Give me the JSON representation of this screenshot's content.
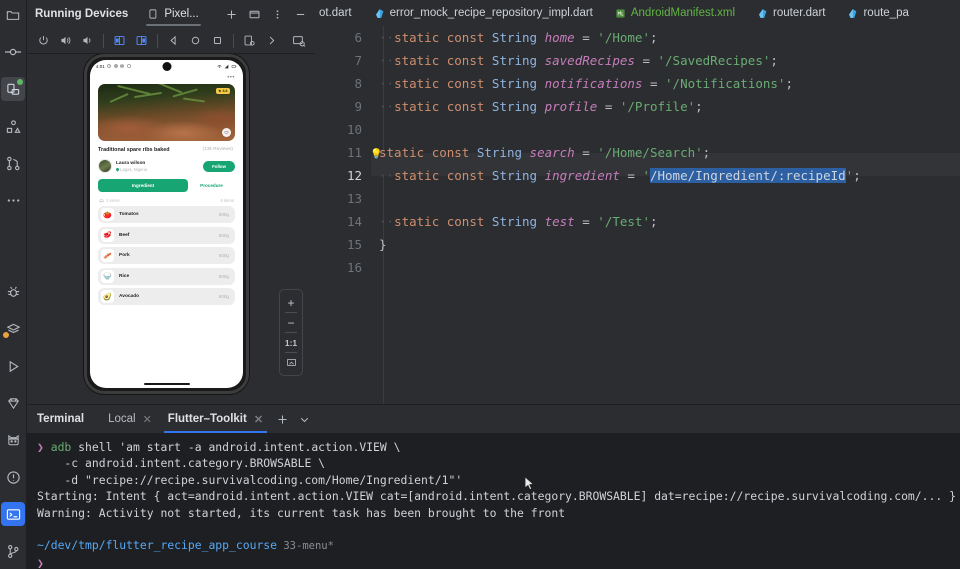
{
  "left_rail": {
    "items": [
      {
        "name": "project-folder-icon",
        "label": "Project"
      },
      {
        "name": "commit-icon",
        "label": "Commit"
      },
      {
        "name": "running-devices-icon",
        "label": "Running Devices",
        "selected": true,
        "badge": "green"
      },
      {
        "name": "structure-icon",
        "label": "Structure"
      },
      {
        "name": "pull-requests-icon",
        "label": "Pull Requests"
      },
      {
        "name": "more-tool-windows-icon",
        "label": "More"
      }
    ],
    "bottom_items": [
      {
        "name": "debug-icon",
        "label": "Debug"
      },
      {
        "name": "layers-icon",
        "label": "Layers",
        "badge": "amber"
      },
      {
        "name": "run-icon",
        "label": "Run"
      },
      {
        "name": "flutter-diamond-icon",
        "label": "Flutter Inspector"
      },
      {
        "name": "cat-icon",
        "label": "Dart Analysis"
      },
      {
        "name": "problems-icon",
        "label": "Problems"
      },
      {
        "name": "terminal-icon",
        "label": "Terminal",
        "selected": true
      },
      {
        "name": "version-control-icon",
        "label": "Version Control"
      }
    ]
  },
  "running_devices": {
    "title": "Running Devices",
    "tab_label": "Pixel...",
    "header_actions": [
      {
        "name": "add-device-button",
        "glyph": "+"
      },
      {
        "name": "split-window-button",
        "glyph": "▭"
      },
      {
        "name": "options-button",
        "glyph": "⋮"
      },
      {
        "name": "hide-button",
        "glyph": "—"
      }
    ],
    "toolbar": [
      {
        "name": "power-button",
        "label": "Power"
      },
      {
        "name": "volume-up-button",
        "label": "Volume Up"
      },
      {
        "name": "volume-down-button",
        "label": "Volume Down"
      },
      {
        "name": "rotate-left-button",
        "label": "Rotate Left"
      },
      {
        "name": "rotate-right-button",
        "label": "Rotate Right"
      },
      {
        "name": "back-button",
        "label": "Back"
      },
      {
        "name": "home-button",
        "label": "Home"
      },
      {
        "name": "overview-button",
        "label": "Overview"
      },
      {
        "name": "screenshot-button",
        "label": "Screenshot"
      },
      {
        "name": "more-actions-button",
        "label": "More"
      },
      {
        "name": "device-settings-button",
        "label": "Device Settings"
      }
    ],
    "zoom_controls": {
      "zoom_in": "+",
      "zoom_out": "−",
      "actual_size": "1:1",
      "fit_to_screen": "fit"
    }
  },
  "emulator": {
    "status_bar": {
      "time": "4:01",
      "left_icons": [
        "clock-icon",
        "gear-icon",
        "camera-icon",
        "app-icon"
      ],
      "right_icons": [
        "wifi-icon",
        "signal-icon",
        "battery-icon"
      ]
    },
    "app": {
      "overflow_menu": "•••",
      "rating_badge": "4.6",
      "recipe_title": "Traditional spare ribs baked",
      "reviews": "(13k Reviews)",
      "author_name": "Laura wilson",
      "author_location": "Lagos, Nigeria",
      "follow_label": "Follow",
      "tab_ingredient": "Ingredient",
      "tab_procedure": "Procedure",
      "serves_label": "1 serve",
      "items_label": "6 items",
      "ingredients": [
        {
          "icon": "🍅",
          "name": "Tomatos",
          "amount": "500g"
        },
        {
          "icon": "🥩",
          "name": "Beef",
          "amount": "500g"
        },
        {
          "icon": "🥓",
          "name": "Pork",
          "amount": "500g"
        },
        {
          "icon": "🍚",
          "name": "Rice",
          "amount": "500g"
        },
        {
          "icon": "🥑",
          "name": "Avocado",
          "amount": "500g"
        }
      ]
    }
  },
  "editor": {
    "tabs": [
      {
        "name": "tab-bot-dart",
        "label": "ot.dart",
        "icon": "dart-icon",
        "type": "dart",
        "clipped": true
      },
      {
        "name": "tab-error-mock-recipe-repository-impl",
        "label": "error_mock_recipe_repository_impl.dart",
        "icon": "dart-icon",
        "type": "dart"
      },
      {
        "name": "tab-android-manifest",
        "label": "AndroidManifest.xml",
        "icon": "xml-icon",
        "type": "xml"
      },
      {
        "name": "tab-router-dart",
        "label": "router.dart",
        "icon": "dart-icon",
        "type": "dart"
      },
      {
        "name": "tab-route-paths",
        "label": "route_pa",
        "icon": "dart-icon",
        "type": "dart",
        "clipped": true
      }
    ],
    "current_line": 12,
    "selection": "/Home/Ingredient/:recipeId",
    "lines": [
      {
        "num": 6,
        "tokens": [
          {
            "t": "··",
            "c": "dotsep"
          },
          {
            "t": "static",
            "c": "kw"
          },
          {
            "t": " ",
            "c": "op"
          },
          {
            "t": "const",
            "c": "kw"
          },
          {
            "t": " ",
            "c": "op"
          },
          {
            "t": "String",
            "c": "typ"
          },
          {
            "t": " ",
            "c": "op"
          },
          {
            "t": "home",
            "c": "idn"
          },
          {
            "t": " = ",
            "c": "op"
          },
          {
            "t": "'/Home'",
            "c": "str"
          },
          {
            "t": ";",
            "c": "op"
          }
        ],
        "clipped": true
      },
      {
        "num": 7,
        "tokens": [
          {
            "t": "··",
            "c": "dotsep"
          },
          {
            "t": "static",
            "c": "kw"
          },
          {
            "t": " ",
            "c": "op"
          },
          {
            "t": "const",
            "c": "kw"
          },
          {
            "t": " ",
            "c": "op"
          },
          {
            "t": "String",
            "c": "typ"
          },
          {
            "t": " ",
            "c": "op"
          },
          {
            "t": "savedRecipes",
            "c": "idn"
          },
          {
            "t": " = ",
            "c": "op"
          },
          {
            "t": "'/SavedRecipes'",
            "c": "str"
          },
          {
            "t": ";",
            "c": "op"
          }
        ]
      },
      {
        "num": 8,
        "tokens": [
          {
            "t": "··",
            "c": "dotsep"
          },
          {
            "t": "static",
            "c": "kw"
          },
          {
            "t": " ",
            "c": "op"
          },
          {
            "t": "const",
            "c": "kw"
          },
          {
            "t": " ",
            "c": "op"
          },
          {
            "t": "String",
            "c": "typ"
          },
          {
            "t": " ",
            "c": "op"
          },
          {
            "t": "notifications",
            "c": "idn"
          },
          {
            "t": " = ",
            "c": "op"
          },
          {
            "t": "'/Notifications'",
            "c": "str"
          },
          {
            "t": ";",
            "c": "op"
          }
        ]
      },
      {
        "num": 9,
        "tokens": [
          {
            "t": "··",
            "c": "dotsep"
          },
          {
            "t": "static",
            "c": "kw"
          },
          {
            "t": " ",
            "c": "op"
          },
          {
            "t": "const",
            "c": "kw"
          },
          {
            "t": " ",
            "c": "op"
          },
          {
            "t": "String",
            "c": "typ"
          },
          {
            "t": " ",
            "c": "op"
          },
          {
            "t": "profile",
            "c": "idn"
          },
          {
            "t": " = ",
            "c": "op"
          },
          {
            "t": "'/Profile'",
            "c": "str"
          },
          {
            "t": ";",
            "c": "op"
          }
        ]
      },
      {
        "num": 10,
        "tokens": []
      },
      {
        "num": 11,
        "bulb": true,
        "tokens": [
          {
            "t": "static",
            "c": "kw"
          },
          {
            "t": " ",
            "c": "op"
          },
          {
            "t": "const",
            "c": "kw"
          },
          {
            "t": " ",
            "c": "op"
          },
          {
            "t": "String",
            "c": "typ"
          },
          {
            "t": " ",
            "c": "op"
          },
          {
            "t": "search",
            "c": "idn"
          },
          {
            "t": " = ",
            "c": "op"
          },
          {
            "t": "'/Home/Search'",
            "c": "str"
          },
          {
            "t": ";",
            "c": "op"
          }
        ]
      },
      {
        "num": 12,
        "current": true,
        "tokens": [
          {
            "t": "··",
            "c": "dotsep"
          },
          {
            "t": "static",
            "c": "kw"
          },
          {
            "t": " ",
            "c": "op"
          },
          {
            "t": "const",
            "c": "kw"
          },
          {
            "t": " ",
            "c": "op"
          },
          {
            "t": "String",
            "c": "typ"
          },
          {
            "t": " ",
            "c": "op"
          },
          {
            "t": "ingredient",
            "c": "idn"
          },
          {
            "t": " = ",
            "c": "op"
          },
          {
            "t": "'",
            "c": "str"
          },
          {
            "t": "/Home/Ingredient/:recipeId",
            "c": "sel"
          },
          {
            "t": "'",
            "c": "str"
          },
          {
            "t": ";",
            "c": "op"
          }
        ]
      },
      {
        "num": 13,
        "tokens": []
      },
      {
        "num": 14,
        "tokens": [
          {
            "t": "··",
            "c": "dotsep"
          },
          {
            "t": "static",
            "c": "kw"
          },
          {
            "t": " ",
            "c": "op"
          },
          {
            "t": "const",
            "c": "kw"
          },
          {
            "t": " ",
            "c": "op"
          },
          {
            "t": "String",
            "c": "typ"
          },
          {
            "t": " ",
            "c": "op"
          },
          {
            "t": "test",
            "c": "idn"
          },
          {
            "t": " = ",
            "c": "op"
          },
          {
            "t": "'/Test'",
            "c": "str"
          },
          {
            "t": ";",
            "c": "op"
          }
        ]
      },
      {
        "num": 15,
        "tokens": [
          {
            "t": "}",
            "c": "brc"
          }
        ]
      },
      {
        "num": 16,
        "tokens": []
      }
    ]
  },
  "terminal": {
    "title": "Terminal",
    "tabs": [
      {
        "name": "terminal-tab-local",
        "label": "Local",
        "active": false
      },
      {
        "name": "terminal-tab-flutter-toolkit",
        "label": "Flutter–Toolkit",
        "active": true
      }
    ],
    "add_label": "+",
    "chevron_label": "⌄",
    "lines": [
      [
        {
          "t": "❯ ",
          "c": "t-prompt"
        },
        {
          "t": "adb",
          "c": "t-cmd"
        },
        {
          "t": " shell 'am start -a android.intent.action.VIEW \\",
          "c": "t-plain"
        }
      ],
      [
        {
          "t": "    -c android.intent.category.BROWSABLE \\",
          "c": "t-plain"
        }
      ],
      [
        {
          "t": "    -d \"recipe://recipe.survivalcoding.com/Home/Ingredient/1\"'",
          "c": "t-plain"
        }
      ],
      [
        {
          "t": "Starting: Intent { act=android.intent.action.VIEW cat=[android.intent.category.BROWSABLE] dat=recipe://recipe.survivalcoding.com/... }",
          "c": "t-plain"
        }
      ],
      [
        {
          "t": "Warning: Activity not started, its current task has been brought to the front",
          "c": "t-plain"
        }
      ],
      [],
      [
        {
          "t": "~/dev/tmp/flutter_recipe_app_course",
          "c": "t-path"
        },
        {
          "t": " 33-menu*",
          "c": "t-branch"
        }
      ],
      [
        {
          "t": "❯",
          "c": "t-prompt"
        }
      ]
    ]
  }
}
